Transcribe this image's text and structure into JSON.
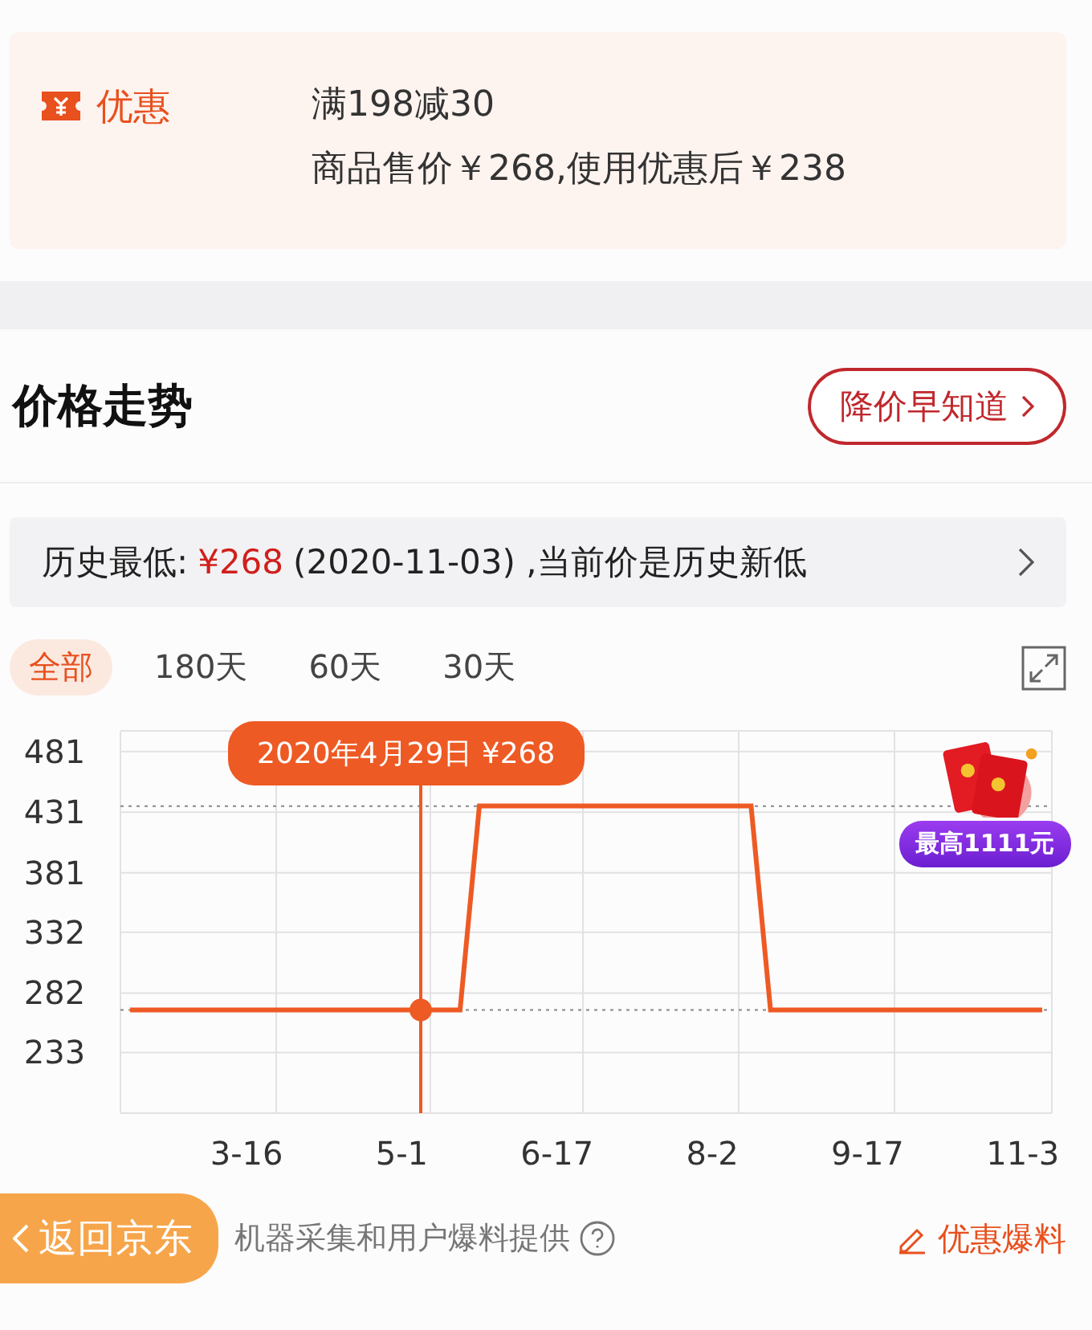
{
  "coupon": {
    "label": "优惠",
    "rule": "满198减30",
    "detail": "商品售价￥268,使用优惠后￥238"
  },
  "price_trend": {
    "title": "价格走势",
    "alert_button": "降价早知道",
    "history": {
      "label": "历史最低:",
      "price": "¥268",
      "note": "(2020-11-03) ,当前价是历史新低"
    },
    "tabs": [
      {
        "label": "全部",
        "selected": true
      },
      {
        "label": "180天",
        "selected": false
      },
      {
        "label": "60天",
        "selected": false
      },
      {
        "label": "30天",
        "selected": false
      }
    ],
    "tooltip": "2020年4月29日 ¥268",
    "promo_badge": "最高1111元",
    "chart_data": {
      "type": "line",
      "categories": [
        null,
        null,
        null,
        null,
        null,
        null,
        "3-16",
        null,
        null,
        null,
        null,
        null,
        null,
        null,
        "5-1",
        null,
        null,
        null,
        null,
        null,
        null,
        null,
        "6-17",
        null,
        null,
        null,
        null,
        null,
        null,
        null,
        "8-2",
        null,
        null,
        null,
        null,
        null,
        null,
        null,
        "9-17",
        null,
        null,
        null,
        null,
        null,
        null,
        null,
        "11-3",
        null
      ],
      "ylim": [
        183,
        498
      ],
      "grid": true,
      "ref_lines": [
        {
          "axis": "y",
          "value": 436
        },
        {
          "axis": "y",
          "value": 268
        }
      ],
      "yticks": [
        233,
        282,
        332,
        381,
        431,
        481
      ],
      "series": [
        {
          "color": "#ee5a24",
          "values": [
            268,
            268,
            268,
            268,
            268,
            268,
            268,
            268,
            268,
            268,
            268,
            268,
            268,
            268,
            268,
            268,
            268,
            268,
            436,
            436,
            436,
            436,
            436,
            436,
            436,
            436,
            436,
            436,
            436,
            436,
            436,
            436,
            436,
            268,
            268,
            268,
            268,
            268,
            268,
            268,
            268,
            268,
            268,
            268,
            268,
            268,
            268,
            268
          ]
        }
      ]
    }
  },
  "footer": {
    "source": "机器采集和用户爆料提供",
    "report_link": "优惠爆料",
    "back_button": "返回京东"
  }
}
